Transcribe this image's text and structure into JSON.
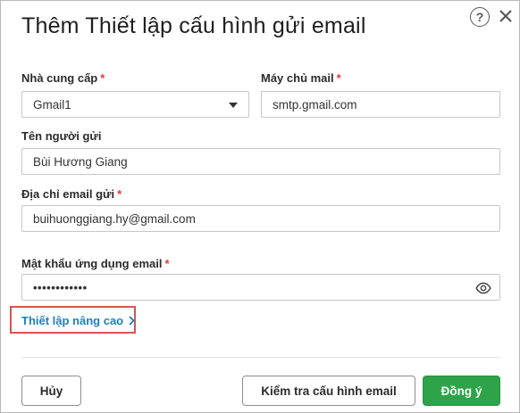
{
  "dialog": {
    "title": "Thêm Thiết lập cấu hình gửi email",
    "help_symbol": "?",
    "icons": {
      "help": "help-circle-icon",
      "close": "close-icon",
      "eye": "eye-icon",
      "dropdown": "chevron-down-icon",
      "advanced": "chevron-right-icon"
    }
  },
  "form": {
    "provider": {
      "label": "Nhà cung cấp",
      "required_mark": "*",
      "value": "Gmail1"
    },
    "mail_server": {
      "label": "Máy chủ mail",
      "required_mark": "*",
      "value": "smtp.gmail.com"
    },
    "sender_name": {
      "label": "Tên người gửi",
      "value": "Bùi Hương Giang"
    },
    "sender_email": {
      "label": "Địa chỉ email gửi",
      "required_mark": "*",
      "value": "buihuonggiang.hy@gmail.com"
    },
    "app_password": {
      "label": "Mật khẩu ứng dụng email",
      "required_mark": "*",
      "value": "••••••••••••"
    },
    "advanced_link": "Thiết lập nâng cao"
  },
  "footer": {
    "cancel_label": "Hủy",
    "test_label": "Kiểm tra cấu hình email",
    "ok_label": "Đồng ý"
  },
  "colors": {
    "accent_green": "#2fa34a",
    "link_blue": "#1a7fc1",
    "required_red": "#e53935",
    "highlight_red": "#d9534f"
  }
}
